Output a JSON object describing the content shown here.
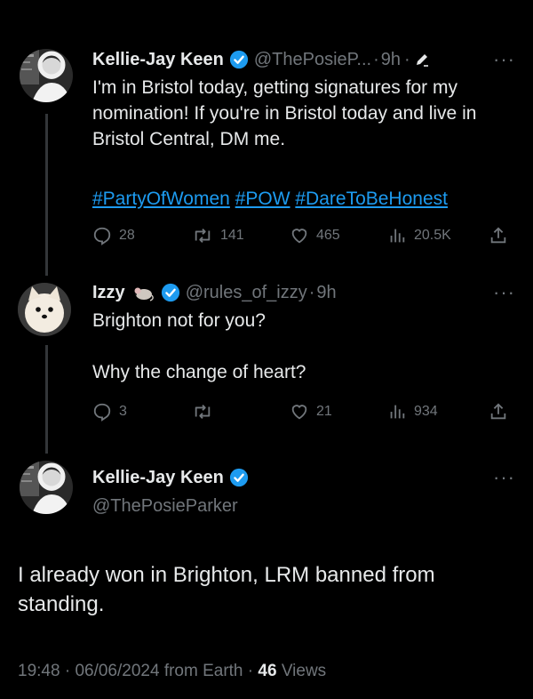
{
  "colors": {
    "background": "#000000",
    "text": "#e7e9ea",
    "muted": "#71767b",
    "link": "#1d9bf0",
    "thread_line": "#333639"
  },
  "tweet1": {
    "name": "Kellie-Jay Keen",
    "handle": "@ThePosieP...",
    "separator": "·",
    "time": "9h",
    "separator2": "·",
    "more": "···",
    "body_line1": "I'm in Bristol today, getting signatures for my nomination! If you're in Bristol today and live in Bristol Central, DM me.",
    "hashtags": [
      "#PartyOfWomen",
      "#POW",
      "#DareToBeHonest"
    ],
    "stats": {
      "replies": "28",
      "reposts": "141",
      "likes": "465",
      "views": "20.5K"
    }
  },
  "tweet2": {
    "name": "Izzy",
    "handle": "@rules_of_izzy",
    "separator": "·",
    "time": "9h",
    "more": "···",
    "body_line1": "Brighton not for you?",
    "body_line2": "Why the change of heart?",
    "stats": {
      "replies": "3",
      "reposts": "",
      "likes": "21",
      "views": "934"
    }
  },
  "main_tweet": {
    "name": "Kellie-Jay Keen",
    "handle": "@ThePosieParker",
    "more": "···",
    "body": "I already won in Brighton, LRM banned from standing.",
    "time": "19:48",
    "sep1": "·",
    "date": "06/06/2024",
    "source": "from Earth",
    "sep2": "·",
    "views_count": "46",
    "views_label": "Views"
  },
  "icons": [
    "verified-badge-icon",
    "edit-pencil-icon",
    "reply-icon",
    "repost-icon",
    "like-icon",
    "views-icon",
    "share-icon",
    "mouse-emoji-icon"
  ]
}
